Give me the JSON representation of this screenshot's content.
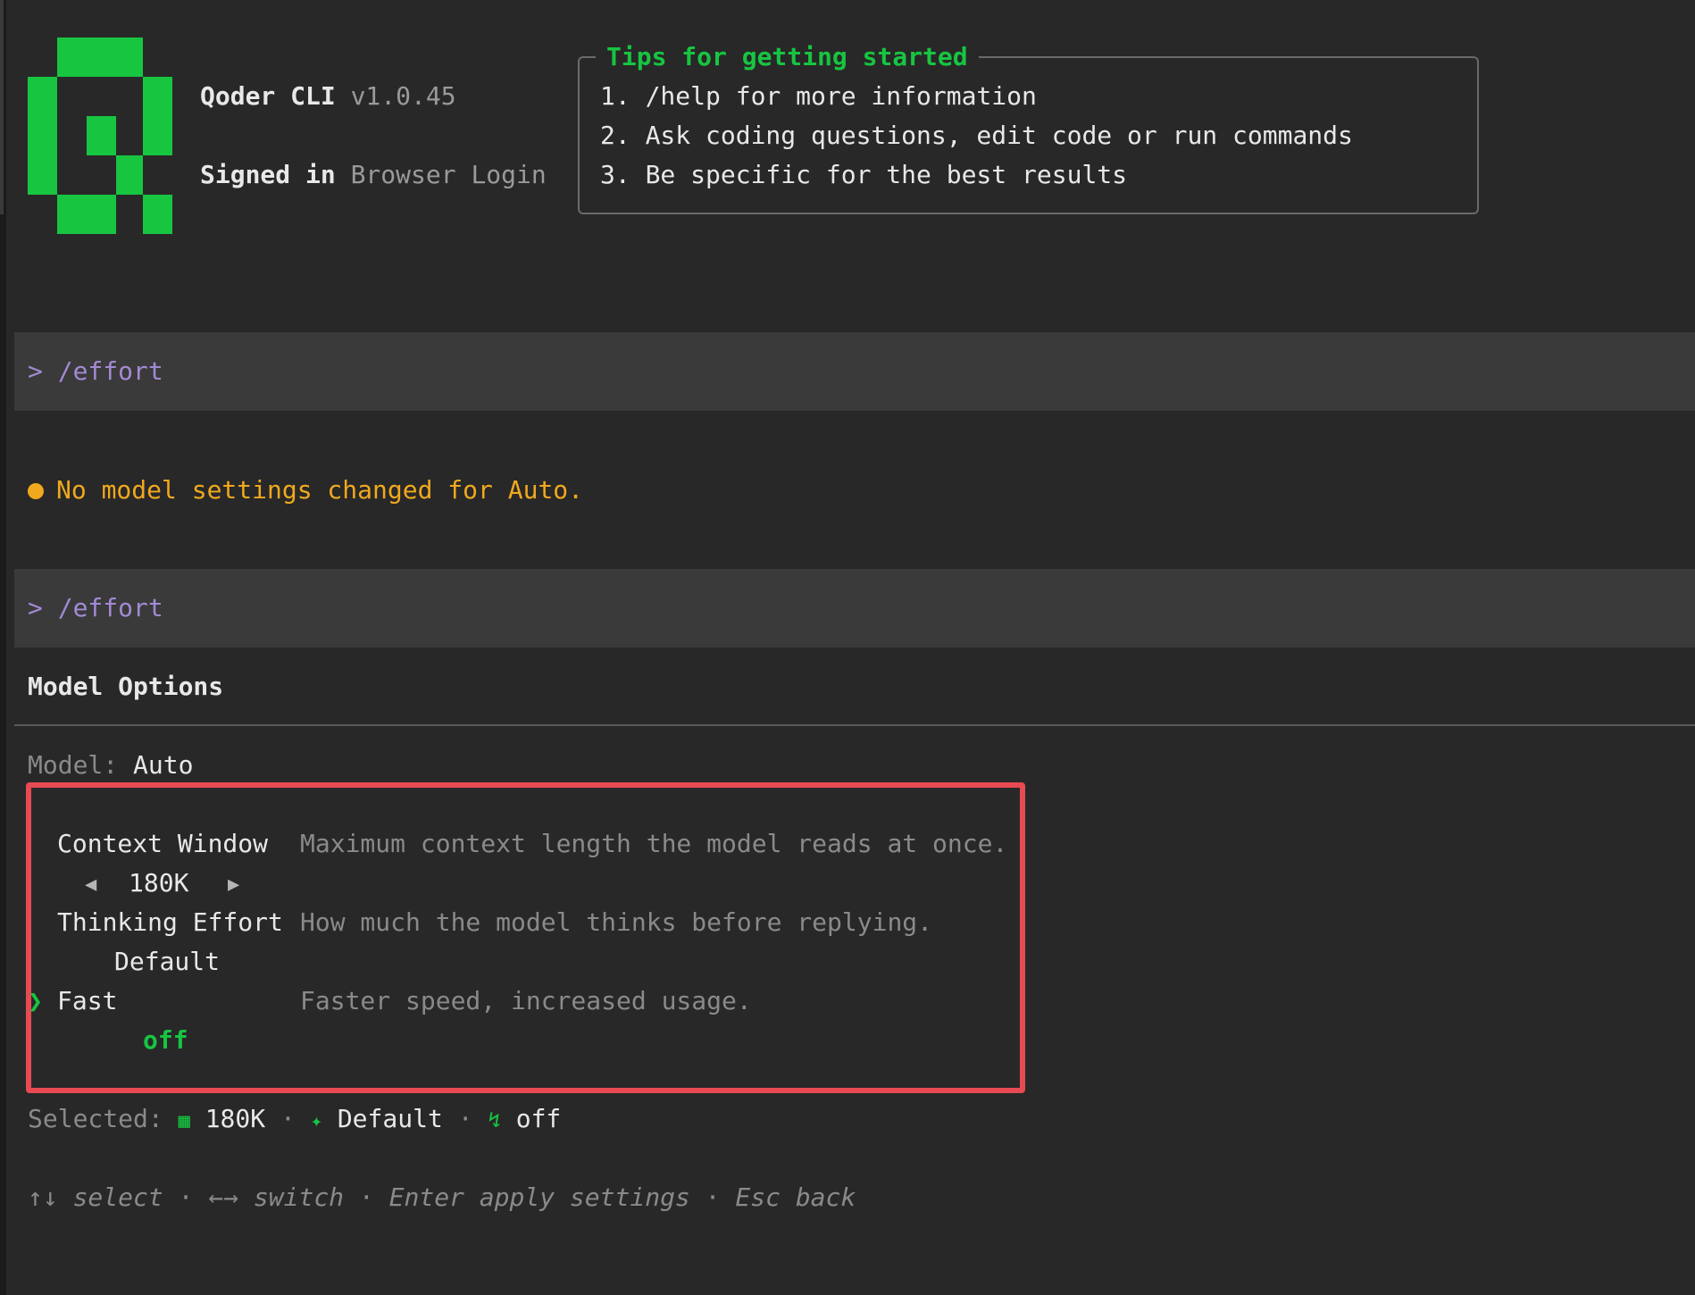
{
  "header": {
    "app_name": "Qoder CLI",
    "version": "v1.0.45",
    "signed_in_label": "Signed in",
    "signed_in_value": "Browser Login"
  },
  "tips": {
    "title": "Tips for getting started",
    "items": [
      "1. /help for more information",
      "2. Ask coding questions, edit code or run commands",
      "3. Be specific for the best results"
    ]
  },
  "history": [
    {
      "prompt": "> /effort"
    },
    {
      "prompt": "> /effort"
    }
  ],
  "status_message": "No model settings changed for Auto.",
  "model_options": {
    "title": "Model Options",
    "model_label": "Model:",
    "model_value": "Auto",
    "options": [
      {
        "name": "Context Window",
        "description": "Maximum context length the model reads at once.",
        "value": "180K",
        "left_arrow": "◀",
        "right_arrow": "▶"
      },
      {
        "name": "Thinking Effort",
        "description": "How much the model thinks before replying.",
        "value": "Default"
      },
      {
        "name": "Fast",
        "description": "Faster speed, increased usage.",
        "value": "off",
        "selected": true,
        "cursor": "❯"
      }
    ]
  },
  "selected_summary": {
    "label": "Selected:",
    "context_icon": "grid-icon",
    "context_value": "180K",
    "separator": "·",
    "effort_icon": "sparkle-icon",
    "effort_value": "Default",
    "fast_icon": "bolt-icon",
    "fast_value": "off"
  },
  "keybindings": [
    {
      "keys": "↑↓",
      "action": "select"
    },
    {
      "keys": "←→",
      "action": "switch"
    },
    {
      "keys": "Enter",
      "action": "apply settings"
    },
    {
      "keys": "Esc",
      "action": "back"
    }
  ],
  "colors": {
    "background": "#282828",
    "accent_green": "#17c541",
    "command_purple": "#a28ad4",
    "warning_orange": "#f0a81e",
    "highlight_red": "#e84a53"
  }
}
